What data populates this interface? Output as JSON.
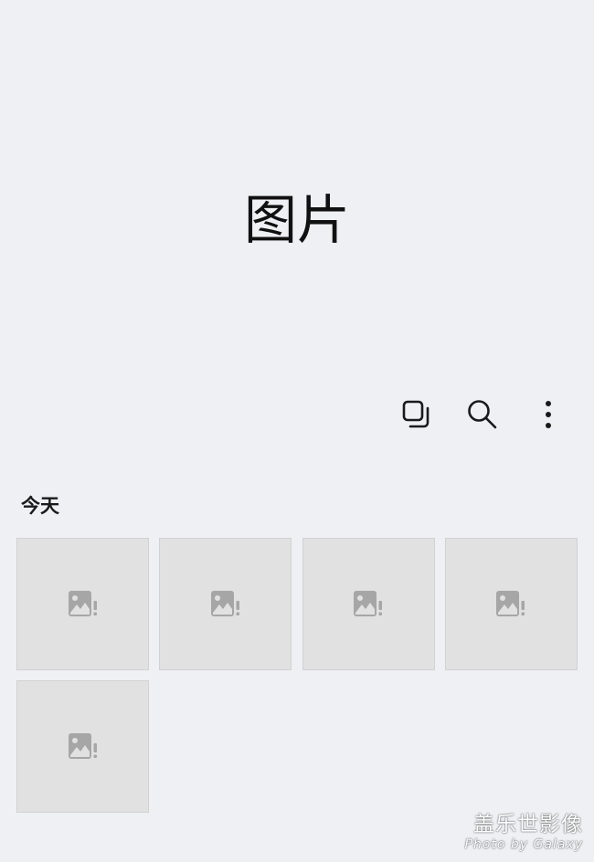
{
  "header": {
    "title": "图片"
  },
  "toolbar": {
    "actions": [
      {
        "name": "select-copy",
        "icon": "copy-stack-icon"
      },
      {
        "name": "search",
        "icon": "search-icon"
      },
      {
        "name": "more-options",
        "icon": "more-vertical-icon"
      }
    ]
  },
  "section": {
    "label": "今天"
  },
  "thumbnails": {
    "count": 5,
    "state": "image-load-error-placeholder",
    "icon": "broken-image-icon"
  },
  "watermark": {
    "line1": "盖乐世影像",
    "line2": "Photo by Galaxy"
  },
  "colors": {
    "background": "#eff0f4",
    "thumbnail_bg": "#e1e1e1",
    "placeholder_icon": "#a6a6a6",
    "toolbar_icon": "#1a1a1a"
  }
}
